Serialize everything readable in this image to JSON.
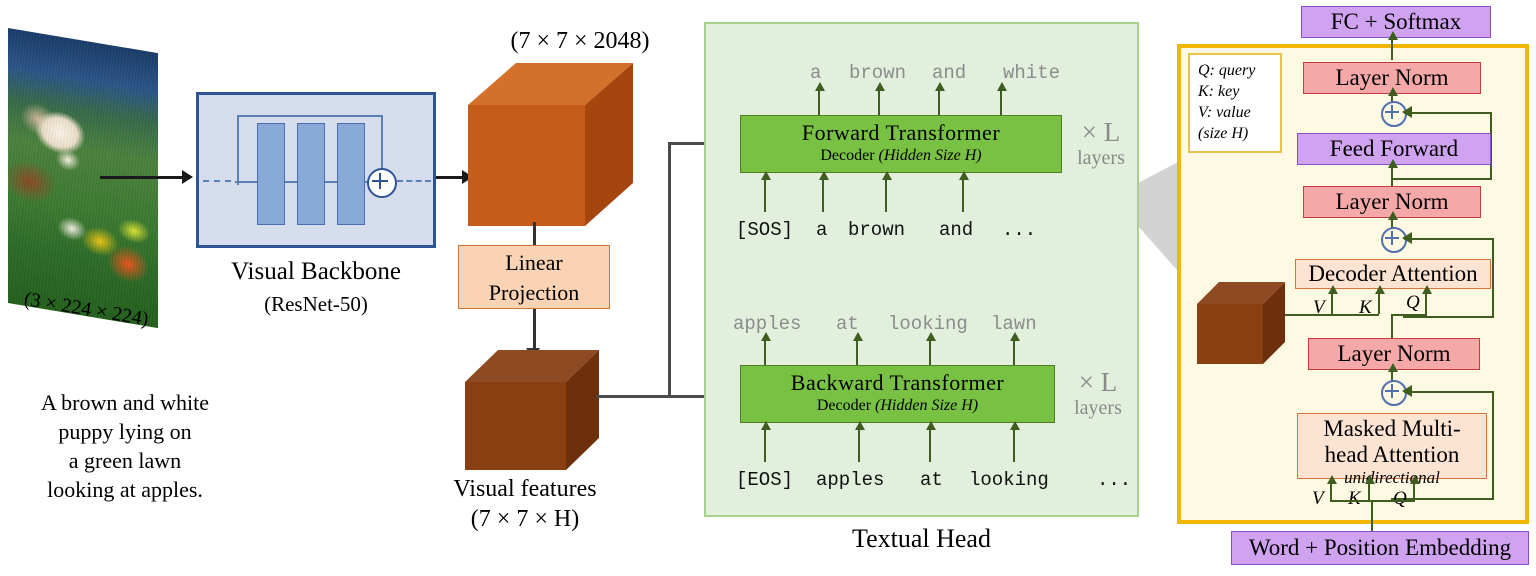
{
  "left": {
    "photo_alt": "puppy-photo",
    "photo_dim_label": "(3 × 224 × 224)",
    "caption_lines": [
      "A brown and white",
      "puppy lying on",
      "a green lawn",
      "looking at apples."
    ],
    "backbone": {
      "title": "Visual Backbone",
      "subtitle": "(ResNet-50)"
    }
  },
  "middle": {
    "big_cube_label": "(7 × 7 × 2048)",
    "linear_projection": {
      "line1": "Linear",
      "line2": "Projection"
    },
    "visual_features": {
      "line1": "Visual features",
      "line2": "(7 × 7 × H)"
    }
  },
  "textual_head": {
    "label": "Textual Head",
    "forward": {
      "title": "Forward  Transformer",
      "subtitle_prefix": "Decoder ",
      "subtitle_italic": "(Hidden Size H)",
      "outputs": [
        "a",
        "brown",
        "and",
        "white"
      ],
      "inputs": [
        "[SOS]",
        "a",
        "brown",
        "and",
        "..."
      ],
      "multiplier": "× L",
      "multiplier_sub": "layers"
    },
    "backward": {
      "title": "Backward  Transformer",
      "subtitle_prefix": "Decoder ",
      "subtitle_italic": "(Hidden Size H)",
      "outputs": [
        "apples",
        "at",
        "looking",
        "lawn"
      ],
      "inputs": [
        "[EOS]",
        "apples",
        "at",
        "looking",
        "..."
      ],
      "multiplier": "× L",
      "multiplier_sub": "layers"
    }
  },
  "right_panel": {
    "legend_lines": [
      "Q: query",
      "K: key",
      "V: value",
      "(size H)"
    ],
    "fc_softmax": "FC + Softmax",
    "layer_norm_top": "Layer Norm",
    "feed_forward": "Feed Forward",
    "layer_norm_mid": "Layer Norm",
    "decoder_attention": "Decoder Attention",
    "layer_norm_bottom": "Layer Norm",
    "masked_attention_l1": "Masked Multi-",
    "masked_attention_l2": "head Attention",
    "masked_attention_sub": "unidirectional",
    "word_position_embedding": "Word + Position Embedding",
    "decoder_vkq": [
      "V",
      "K",
      "Q"
    ],
    "masked_vkq": [
      "V",
      "K",
      "Q"
    ]
  },
  "colors": {
    "transformer_green": "#79c143",
    "textual_head_bg": "#e2efdc",
    "panel_border": "#f2b705",
    "panel_bg": "#fdf9e3",
    "purple": "#cfa3f0",
    "red": "#f5a8a8",
    "peach": "#fde4d2",
    "cube_big": "#c75b1a",
    "cube_small": "#8a3f12",
    "backbone_bg": "#d5dded",
    "backbone_border": "#2e5493"
  }
}
